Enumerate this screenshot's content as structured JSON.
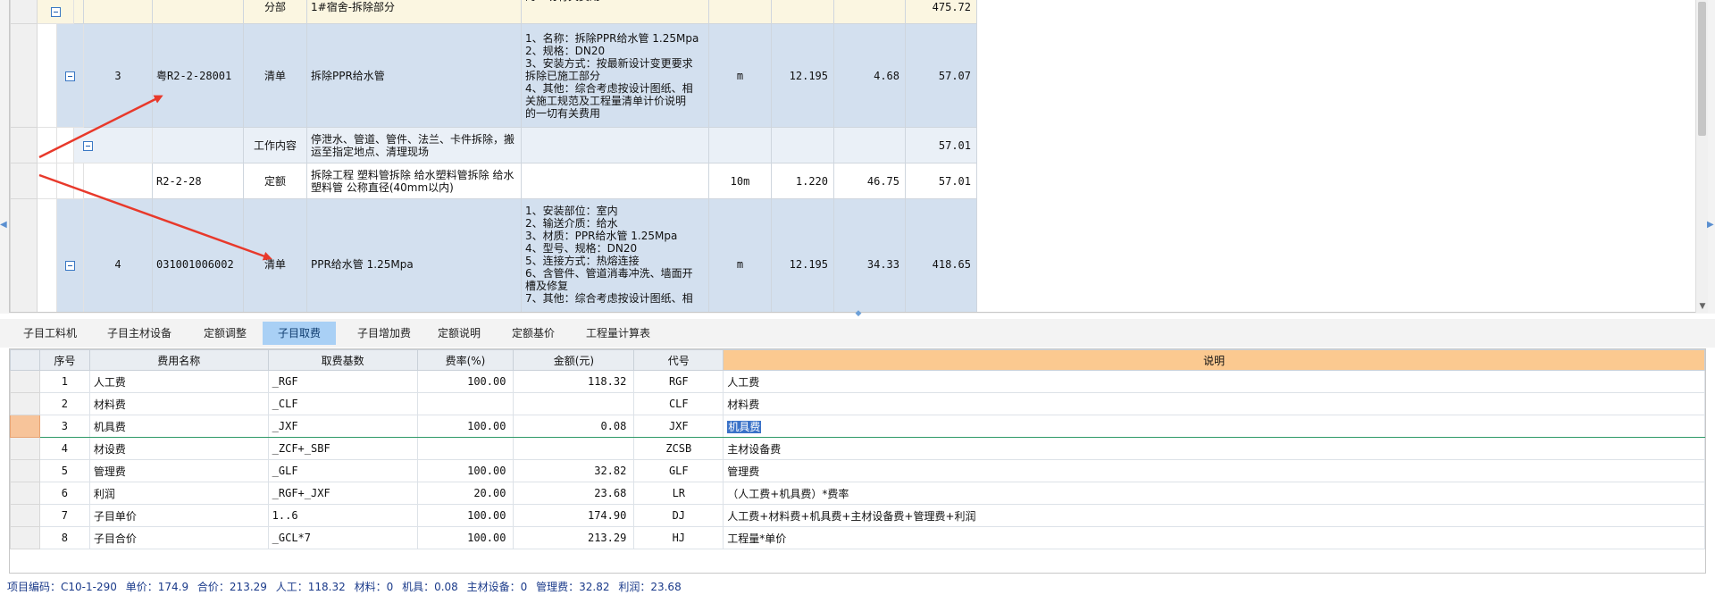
{
  "upper": {
    "rows": [
      {
        "kind": "fb",
        "type": "分部",
        "name": "1#宿舍-拆除部分",
        "desc": "的一切有关费用",
        "amount": "475.72"
      },
      {
        "kind": "qd",
        "no": "3",
        "code": "粤R2-2-28001",
        "type": "清单",
        "name": "拆除PPR给水管",
        "desc": [
          "1、名称：拆除PPR给水管 1.25Mpa",
          "2、规格：DN20",
          "3、安装方式：按最新设计变更要求",
          "拆除已施工部分",
          "4、其他：综合考虑按设计图纸、相",
          "关施工规范及工程量清单计价说明",
          "的一切有关费用"
        ],
        "unit": "m",
        "qty": "12.195",
        "price": "4.68",
        "amount": "57.07"
      },
      {
        "kind": "gz",
        "type": "工作内容",
        "name": "停泄水、管道、管件、法兰、卡件拆除，搬运至指定地点、清理现场",
        "amount": "57.01"
      },
      {
        "kind": "de",
        "code": "R2-2-28",
        "type": "定额",
        "name": "拆除工程 塑料管拆除 给水塑料管拆除 给水塑料管 公称直径(40mm以内)",
        "unit": "10m",
        "qty": "1.220",
        "price": "46.75",
        "amount": "57.01"
      },
      {
        "kind": "qd",
        "no": "4",
        "code": "031001006002",
        "type": "清单",
        "name": "PPR给水管 1.25Mpa",
        "desc": [
          "1、安装部位：室内",
          "2、输送介质：给水",
          "3、材质：PPR给水管 1.25Mpa",
          "4、型号、规格：DN20",
          "5、连接方式：热熔连接",
          "6、含管件、管道消毒冲洗、墙面开",
          "槽及修复",
          "7、其他：综合考虑按设计图纸、相"
        ],
        "unit": "m",
        "qty": "12.195",
        "price": "34.33",
        "amount": "418.65"
      }
    ]
  },
  "tabs": [
    {
      "label": "子目工料机"
    },
    {
      "label": "子目主材设备"
    },
    {
      "label": "定额调整"
    },
    {
      "label": "子目取费"
    },
    {
      "label": "子目增加费"
    },
    {
      "label": "定额说明"
    },
    {
      "label": "定额基价"
    },
    {
      "label": "工程量计算表"
    }
  ],
  "active_tab": 3,
  "fees": {
    "headers": {
      "no": "序号",
      "name": "费用名称",
      "base": "取费基数",
      "rate": "费率(%)",
      "amount": "金额(元)",
      "code": "代号",
      "desc": "说明"
    },
    "rows": [
      {
        "no": "1",
        "name": "人工费",
        "base": "_RGF",
        "rate": "100.00",
        "amount": "118.32",
        "code": "RGF",
        "desc": "人工费"
      },
      {
        "no": "2",
        "name": "材料费",
        "base": "_CLF",
        "rate": "",
        "amount": "",
        "code": "CLF",
        "desc": "材料费"
      },
      {
        "no": "3",
        "name": "机具费",
        "base": "_JXF",
        "rate": "100.00",
        "amount": "0.08",
        "code": "JXF",
        "desc": "机具费",
        "selected": true
      },
      {
        "no": "4",
        "name": "材设费",
        "base": "_ZCF+_SBF",
        "rate": "",
        "amount": "",
        "code": "ZCSB",
        "desc": "主材设备费"
      },
      {
        "no": "5",
        "name": "管理费",
        "base": "_GLF",
        "rate": "100.00",
        "amount": "32.82",
        "code": "GLF",
        "desc": "管理费"
      },
      {
        "no": "6",
        "name": "利润",
        "base": "_RGF+_JXF",
        "rate": "20.00",
        "amount": "23.68",
        "code": "LR",
        "desc": "（人工费+机具费）*费率"
      },
      {
        "no": "7",
        "name": "子目单价",
        "base": "1..6",
        "rate": "100.00",
        "amount": "174.90",
        "code": "DJ",
        "desc": "人工费+材料费+机具费+主材设备费+管理费+利润"
      },
      {
        "no": "8",
        "name": "子目合价",
        "base": "_GCL*7",
        "rate": "100.00",
        "amount": "213.29",
        "code": "HJ",
        "desc": "工程量*单价"
      }
    ]
  },
  "status": {
    "code_label": "项目编码：",
    "code_value": "C10-1-290",
    "unit_price_label": "单价：",
    "unit_price_value": "174.9",
    "total_label": "合价：",
    "total_value": "213.29",
    "labor_label": "人工：",
    "labor_value": "118.32",
    "material_label": "材料：",
    "material_value": "0",
    "machine_label": "机具：",
    "machine_value": "0.08",
    "main_equip_label": "主材设备：",
    "main_equip_value": "0",
    "mgmt_label": "管理费：",
    "mgmt_value": "32.82",
    "profit_label": "利润：",
    "profit_value": "23.68"
  },
  "colors": {
    "accent": "#a9d0f5",
    "selection_border": "#2f9a68",
    "desc_header": "#fbc990",
    "annotation_arrow": "#e8392b",
    "status_text": "#1a3a8a"
  }
}
